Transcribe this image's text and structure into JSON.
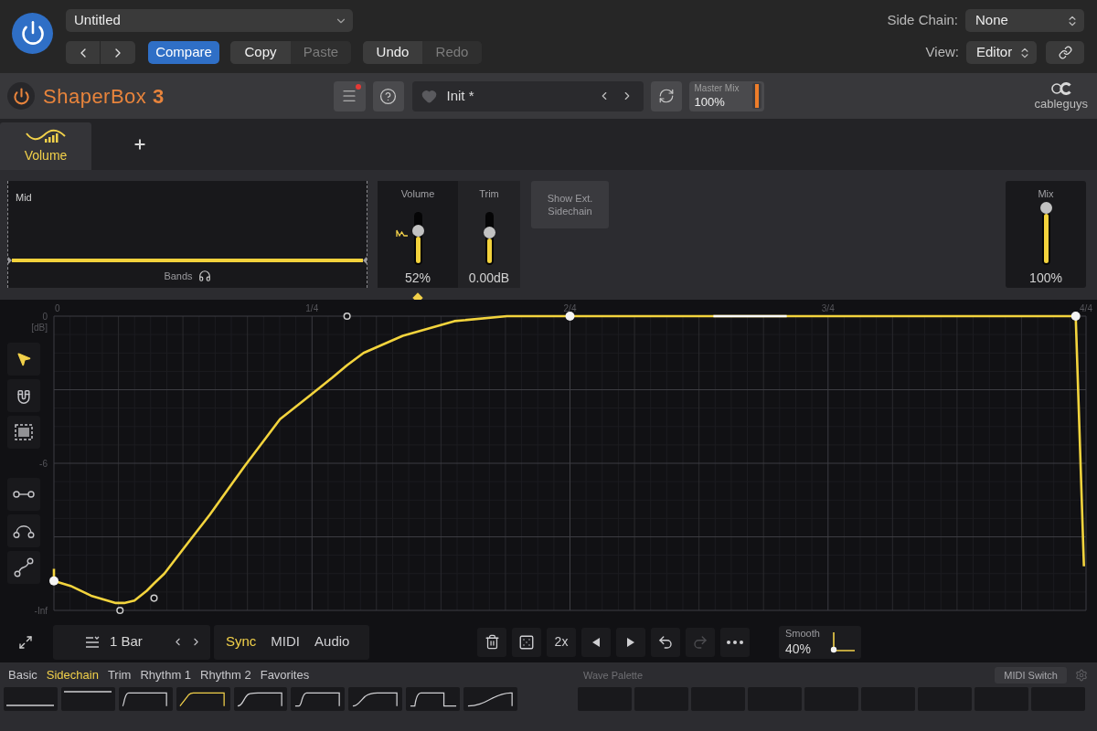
{
  "host_bar": {
    "preset_menu": {
      "value": "Untitled"
    },
    "compare": {
      "label": "Compare",
      "on": true
    },
    "clipboard": [
      {
        "label": "Copy",
        "disabled": false
      },
      {
        "label": "Paste",
        "disabled": true
      }
    ],
    "history": [
      {
        "label": "Undo",
        "disabled": false
      },
      {
        "label": "Redo",
        "disabled": true
      }
    ],
    "side_chain": {
      "label": "Side Chain:",
      "value": "None"
    },
    "view": {
      "label": "View:",
      "value": "Editor"
    }
  },
  "plugin_header": {
    "title": "ShaperBox **3**",
    "menu_alert": true,
    "preset": {
      "name": "Init *",
      "favorite": false
    },
    "master_mix": {
      "label": "Master Mix",
      "value": "100%",
      "level": 1
    },
    "brand": "cableguys"
  },
  "band_tabs": [
    {
      "label": "Volume",
      "selected": true
    }
  ],
  "bands": {
    "label": "Mid",
    "footer": "Bands"
  },
  "controls": [
    {
      "label": "Volume",
      "value": "52%",
      "level": 0.53,
      "targeted": true
    },
    {
      "label": "Trim",
      "value": "0.00dB",
      "level": 0.5,
      "targeted": false
    }
  ],
  "sidechain_button": "Show Ext. Sidechain",
  "mix": {
    "label": "Mix",
    "value": "100%",
    "level": 1
  },
  "editor": {
    "tools": [
      {
        "kind": "pointer",
        "selected": true
      },
      {
        "kind": "magnet",
        "selected": false
      },
      {
        "kind": "marquee",
        "selected": false
      }
    ],
    "shape_tools": [
      {
        "kind": "line"
      },
      {
        "kind": "curve"
      },
      {
        "kind": "s-curve"
      }
    ],
    "chart_data": {
      "type": "line",
      "ylabel": "[dB]",
      "grid": true,
      "x": [
        0,
        0,
        0.016,
        0.036,
        0.06,
        0.064,
        0.068,
        0.078,
        0.09,
        0.097,
        0.107,
        0.127,
        0.151,
        0.185,
        0.219,
        0.249,
        0.27,
        0.284,
        0.3,
        0.338,
        0.388,
        0.439,
        0.479,
        0.5,
        0.639,
        0.71,
        0.99,
        0.998
      ],
      "series": [
        {
          "color": "#f3d43d",
          "values": [
            -10.3,
            -10.8,
            -11.0,
            -11.4,
            -11.7,
            -11.7,
            -11.7,
            -11.6,
            -11.2,
            -10.9,
            -10.5,
            -9.4,
            -8.1,
            -6.1,
            -4.2,
            -3.2,
            -2.5,
            -2.0,
            -1.5,
            -0.8,
            -0.2,
            0,
            0,
            0,
            0,
            0,
            0,
            -10.2
          ]
        },
        {
          "color": "#ffffff",
          "values": [
            null,
            null,
            null,
            null,
            null,
            null,
            null,
            null,
            null,
            null,
            null,
            null,
            null,
            null,
            null,
            null,
            null,
            null,
            null,
            null,
            null,
            null,
            null,
            null,
            0,
            0,
            null,
            null
          ]
        },
        {
          "type": "scatter",
          "color": "#f4f4f4",
          "values": [
            null,
            -10.8,
            null,
            null,
            null,
            null,
            null,
            null,
            null,
            null,
            null,
            null,
            null,
            null,
            null,
            null,
            null,
            null,
            null,
            null,
            null,
            null,
            null,
            0,
            null,
            null,
            0,
            null
          ]
        },
        {
          "type": "scatter",
          "color": "#cfcfcf",
          "values": [
            null,
            null,
            null,
            null,
            null,
            -12,
            null,
            null,
            null,
            -11.5,
            null,
            null,
            null,
            null,
            null,
            null,
            null,
            0,
            null,
            null,
            null,
            null,
            null,
            null,
            null,
            null,
            null,
            null
          ]
        }
      ],
      "xlim": [
        0,
        1
      ],
      "ylim": [
        -12,
        0
      ],
      "xticks": [
        {
          "value": 0,
          "label": "0"
        },
        {
          "value": 0.25,
          "label": "1/4"
        },
        {
          "value": 0.5,
          "label": "2/4"
        },
        {
          "value": 0.75,
          "label": "3/4"
        },
        {
          "value": 1,
          "label": "4/4"
        }
      ],
      "yticks": [
        {
          "value": 0,
          "label": "0"
        },
        {
          "value": -6,
          "label": "-6"
        },
        {
          "value": -12,
          "label": "-Inf"
        }
      ]
    }
  },
  "toolbar": {
    "grid": "1 Bar",
    "modes": [
      {
        "label": "Sync",
        "selected": true
      },
      {
        "label": "MIDI",
        "selected": false
      },
      {
        "label": "Audio",
        "selected": false
      }
    ],
    "actions": [
      {
        "kind": "delete"
      },
      {
        "kind": "randomize"
      },
      {
        "kind": "text",
        "label": "2x"
      },
      {
        "kind": "previous"
      },
      {
        "kind": "next"
      },
      {
        "kind": "undo",
        "disabled": false
      },
      {
        "kind": "redo",
        "disabled": true
      },
      {
        "kind": "more"
      }
    ],
    "smooth": {
      "label": "Smooth",
      "value": "40%"
    }
  },
  "palette": {
    "tabs": [
      {
        "label": "Basic",
        "selected": false
      },
      {
        "label": "Sidechain",
        "selected": true
      },
      {
        "label": "Trim",
        "selected": false
      },
      {
        "label": "Rhythm 1",
        "selected": false
      },
      {
        "label": "Rhythm 2",
        "selected": false
      },
      {
        "label": "Favorites",
        "selected": false
      }
    ],
    "shapes": [
      {
        "kind": "floor",
        "selected": false
      },
      {
        "kind": "ceiling",
        "selected": false
      },
      {
        "kind": "hard-gate",
        "selected": false
      },
      {
        "kind": "ramp-gate",
        "selected": true
      },
      {
        "kind": "soft-gate",
        "selected": false
      },
      {
        "kind": "snap-gate",
        "selected": false
      },
      {
        "kind": "swell-gate",
        "selected": false
      },
      {
        "kind": "short-gate",
        "selected": false
      },
      {
        "kind": "slow-swell",
        "selected": false
      }
    ],
    "wave_palette_label": "Wave Palette",
    "midi_switch": "MIDI Switch"
  }
}
